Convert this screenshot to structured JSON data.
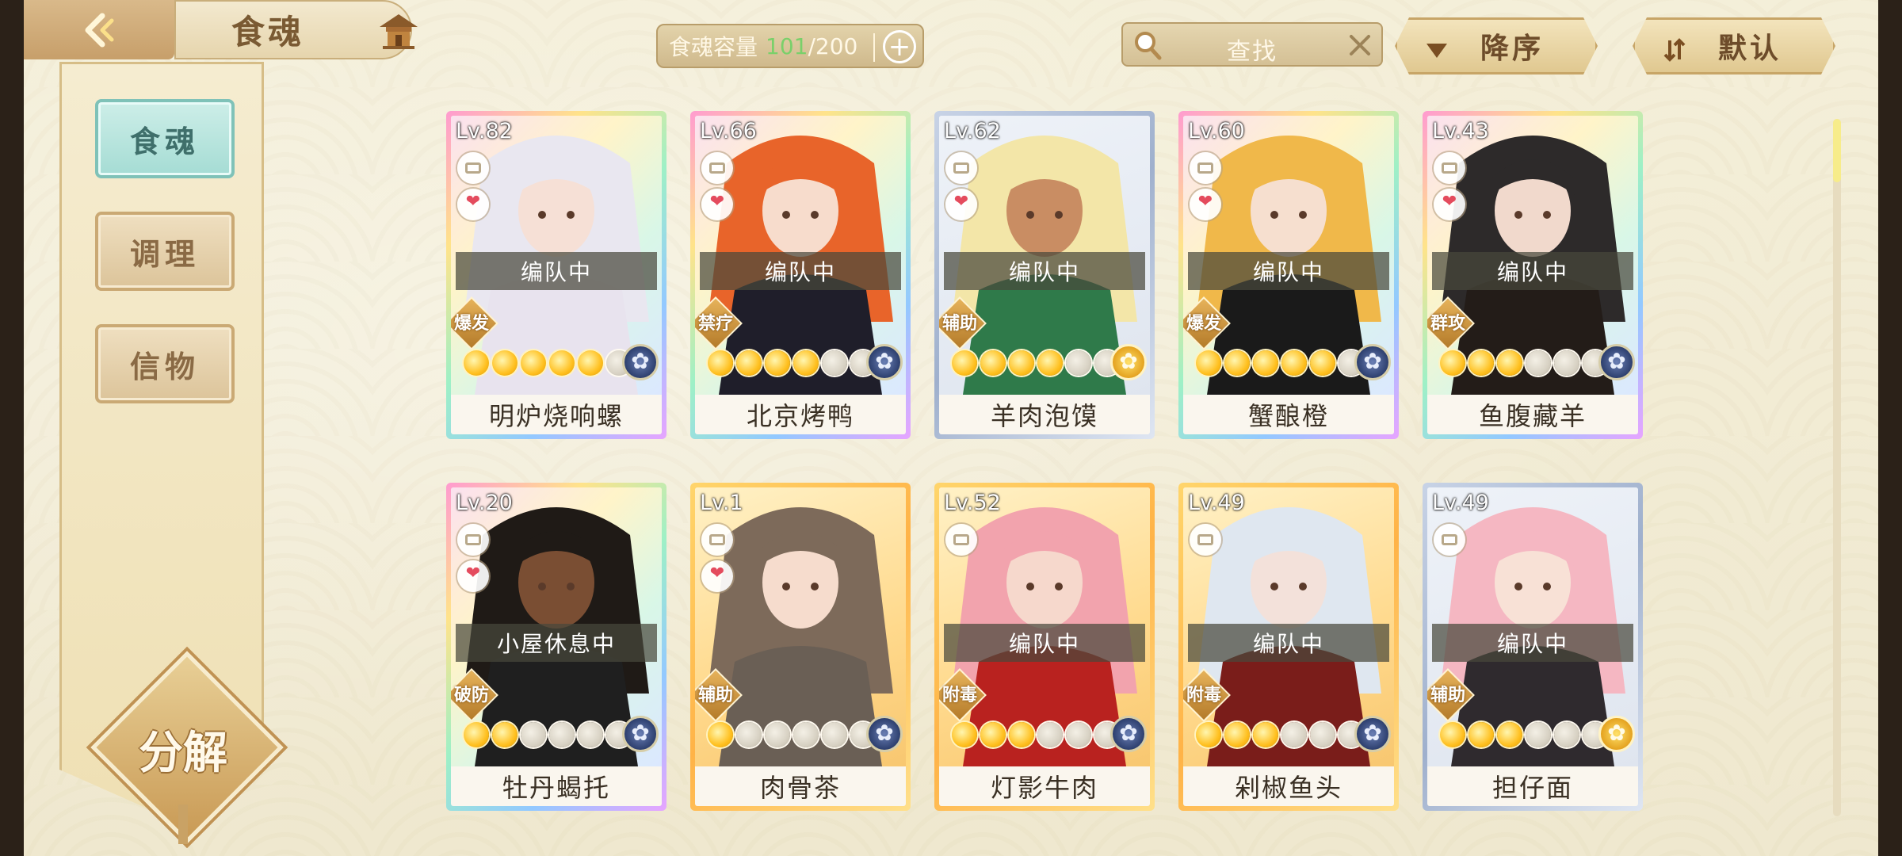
{
  "header": {
    "back_icon": "back-arrow-icon",
    "title": "食魂",
    "house_icon": "pavilion-icon"
  },
  "capacity": {
    "label": "食魂容量",
    "current": "101",
    "separator": "/",
    "max": "200",
    "plus": "+"
  },
  "search": {
    "placeholder": "查找",
    "icon": "search-icon",
    "clear": "✕"
  },
  "sort_button": {
    "label": "降序",
    "icon": "triangle-down-icon"
  },
  "default_button": {
    "label": "默认",
    "icon": "sort-arrows-icon"
  },
  "sidebar": {
    "tabs": [
      {
        "label": "食魂",
        "active": true
      },
      {
        "label": "调理",
        "active": false
      },
      {
        "label": "信物",
        "active": false
      }
    ],
    "decompose_label": "分解"
  },
  "colors": {
    "accent_active_tab": "#a5dcd4",
    "capacity_current": "#7ad06a",
    "frame_gold": "#c7a567"
  },
  "cards": [
    {
      "level": "Lv.82",
      "name": "明炉烧响螺",
      "status": "编队中",
      "role": "爆发",
      "stars": 5,
      "locked": true,
      "favorite": true,
      "rarity": "rainbow",
      "element": "blue"
    },
    {
      "level": "Lv.66",
      "name": "北京烤鸭",
      "status": "编队中",
      "role": "禁疗",
      "stars": 4,
      "locked": true,
      "favorite": true,
      "rarity": "rainbow",
      "element": "blue"
    },
    {
      "level": "Lv.62",
      "name": "羊肉泡馍",
      "status": "编队中",
      "role": "辅助",
      "stars": 4,
      "locked": true,
      "favorite": true,
      "rarity": "silver",
      "element": "yellow"
    },
    {
      "level": "Lv.60",
      "name": "蟹酿橙",
      "status": "编队中",
      "role": "爆发",
      "stars": 5,
      "locked": true,
      "favorite": true,
      "rarity": "rainbow",
      "element": "blue"
    },
    {
      "level": "Lv.43",
      "name": "鱼腹藏羊",
      "status": "编队中",
      "role": "群攻",
      "stars": 3,
      "locked": true,
      "favorite": true,
      "rarity": "rainbow",
      "element": "blue"
    },
    {
      "level": "Lv.20",
      "name": "牡丹蝎托",
      "status": "小屋休息中",
      "role": "破防",
      "stars": 2,
      "locked": true,
      "favorite": true,
      "rarity": "rainbow",
      "element": "blue"
    },
    {
      "level": "Lv.1",
      "name": "肉骨茶",
      "status": "",
      "role": "辅助",
      "stars": 1,
      "locked": true,
      "favorite": true,
      "rarity": "gold",
      "element": "blue"
    },
    {
      "level": "Lv.52",
      "name": "灯影牛肉",
      "status": "编队中",
      "role": "附毒",
      "stars": 3,
      "locked": true,
      "favorite": false,
      "rarity": "gold",
      "element": "blue"
    },
    {
      "level": "Lv.49",
      "name": "剁椒鱼头",
      "status": "编队中",
      "role": "附毒",
      "stars": 3,
      "locked": true,
      "favorite": false,
      "rarity": "gold",
      "element": "blue"
    },
    {
      "level": "Lv.49",
      "name": "担仔面",
      "status": "编队中",
      "role": "辅助",
      "stars": 3,
      "locked": true,
      "favorite": false,
      "rarity": "silver",
      "element": "yellow"
    }
  ]
}
